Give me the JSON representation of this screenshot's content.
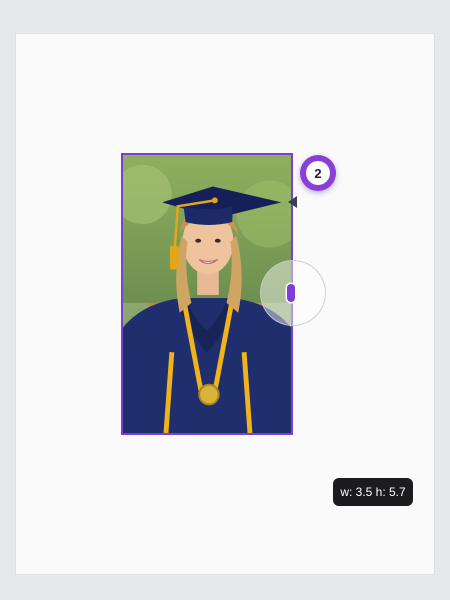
{
  "canvas": {
    "selected_image": {
      "description": "graduation-portrait",
      "selection_color": "#7b3fd6"
    },
    "collaborator_badge": {
      "count": "2",
      "color": "#8b3fd9"
    },
    "resize": {
      "tooltip": "w: 3.5  h: 5.7"
    }
  }
}
